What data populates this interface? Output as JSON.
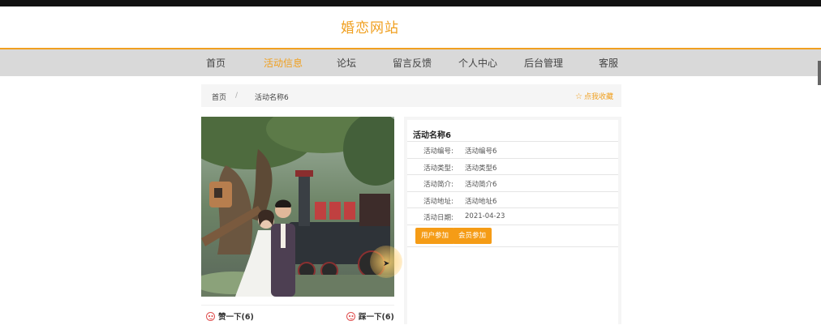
{
  "site": {
    "title": "婚恋网站"
  },
  "nav": {
    "items": [
      {
        "label": "首页",
        "active": false
      },
      {
        "label": "活动信息",
        "active": true
      },
      {
        "label": "论坛",
        "active": false
      },
      {
        "label": "留言反馈",
        "active": false
      },
      {
        "label": "个人中心",
        "active": false
      },
      {
        "label": "后台管理",
        "active": false
      },
      {
        "label": "客服",
        "active": false
      }
    ],
    "accent_color": "#f0a020"
  },
  "breadcrumb": {
    "home": "首页",
    "separator": "/",
    "current": "活动名称6",
    "favorite_label": "点我收藏"
  },
  "photo": {
    "icon": "wedding-photo"
  },
  "reactions": {
    "like_label": "赞一下(6)",
    "dislike_label": "踩一下(6)"
  },
  "detail": {
    "title": "活动名称6",
    "rows": [
      {
        "label": "活动编号:",
        "value": "活动编号6"
      },
      {
        "label": "活动类型:",
        "value": "活动类型6"
      },
      {
        "label": "活动简介:",
        "value": "活动简介6"
      },
      {
        "label": "活动地址:",
        "value": "活动地址6"
      },
      {
        "label": "活动日期:",
        "value": "2021-04-23"
      }
    ],
    "buttons": {
      "user_join": "用户参加",
      "member_join": "会员参加"
    },
    "button_color": "#f59c16"
  }
}
